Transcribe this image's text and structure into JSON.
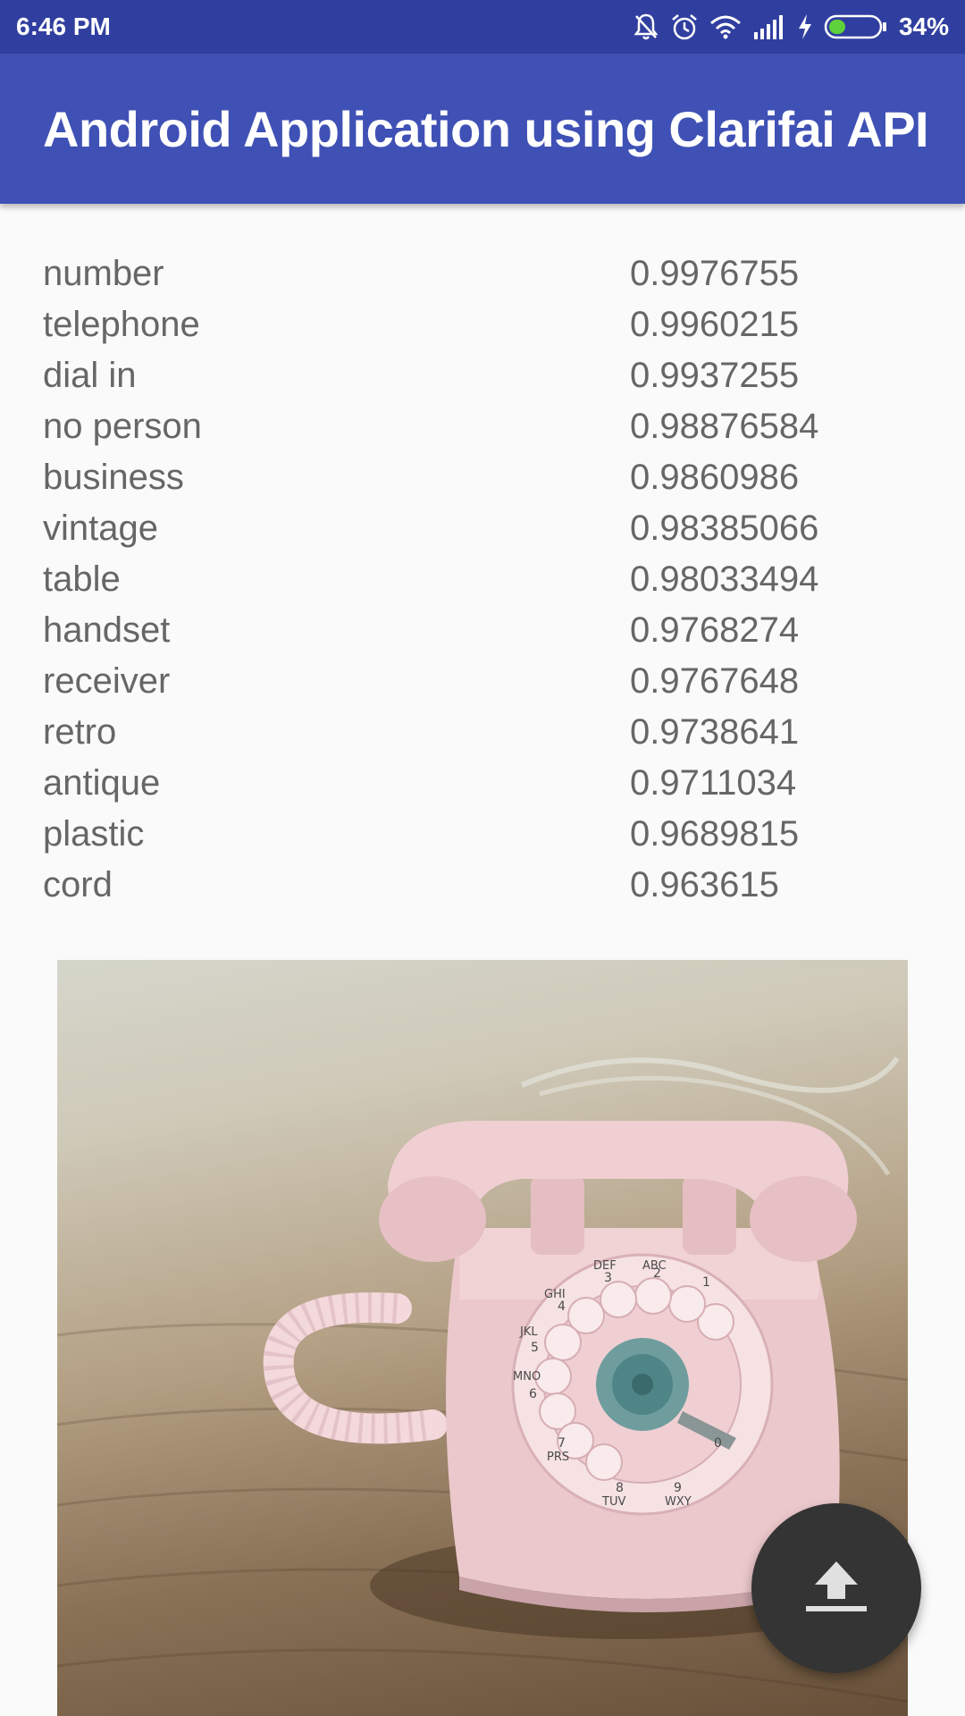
{
  "status_bar": {
    "time": "6:46 PM",
    "battery": "34%",
    "battery_level": 0.34,
    "icons": [
      "notifications-off-icon",
      "alarm-icon",
      "wifi-icon",
      "signal-icon",
      "charging-icon",
      "battery-icon"
    ]
  },
  "app_bar": {
    "title": "Android Application using Clarifai API"
  },
  "results": [
    {
      "label": "number",
      "score": "0.9976755"
    },
    {
      "label": "telephone",
      "score": "0.9960215"
    },
    {
      "label": "dial in",
      "score": "0.9937255"
    },
    {
      "label": "no person",
      "score": "0.98876584"
    },
    {
      "label": "business",
      "score": "0.9860986"
    },
    {
      "label": "vintage",
      "score": "0.98385066"
    },
    {
      "label": "table",
      "score": "0.98033494"
    },
    {
      "label": "handset",
      "score": "0.9768274"
    },
    {
      "label": "receiver",
      "score": "0.9767648"
    },
    {
      "label": "retro",
      "score": "0.9738641"
    },
    {
      "label": "antique",
      "score": "0.9711034"
    },
    {
      "label": "plastic",
      "score": "0.9689815"
    },
    {
      "label": "cord",
      "score": "0.963615"
    }
  ],
  "photo": {
    "icon": "rotary-telephone-photo",
    "dial_letters": {
      "abc": "ABC",
      "def": "DEF",
      "ghi": "GHI",
      "jkl": "JKL",
      "mno": "MNO",
      "prs": "PRS",
      "tuv": "TUV",
      "wxy": "WXY"
    },
    "dial_digits": [
      "1",
      "2",
      "3",
      "4",
      "5",
      "6",
      "7",
      "8",
      "9",
      "0"
    ]
  },
  "fab": {
    "icon": "upload-icon"
  },
  "colors": {
    "status_bar": "#303f9f",
    "app_bar": "#3f51b5",
    "background": "#fafafa",
    "text": "#666666",
    "fab": "#343434"
  }
}
